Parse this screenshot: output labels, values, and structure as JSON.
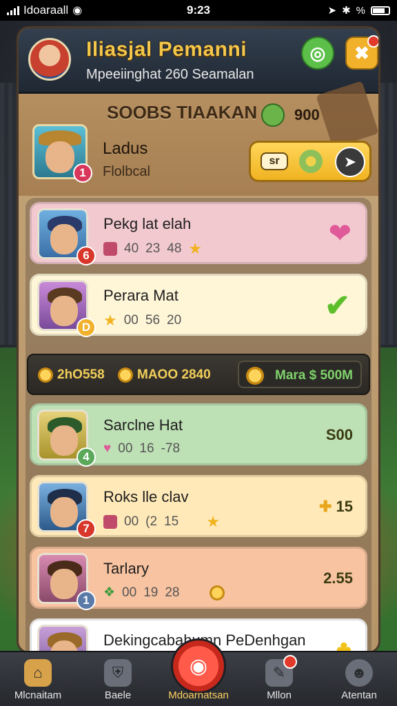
{
  "status_bar": {
    "carrier": "Idoaraall",
    "time": "9:23",
    "battery_text": "%"
  },
  "header": {
    "title": "Iliasjal Pemanni",
    "subtitle": "Mpeeiinghat 260 Seamalan"
  },
  "top_section": {
    "title": "SOOBS TIAAKAN",
    "count": "900",
    "player": {
      "name": "Ladus",
      "position": "Flolbcal",
      "badge": "1",
      "button_chip": "sr"
    }
  },
  "list": {
    "rows": [
      {
        "title": "Pekg lat elah",
        "stats": [
          "40",
          "23",
          "48"
        ],
        "badge": "6",
        "right": ""
      },
      {
        "title": "Perara Mat",
        "stats": [
          "00",
          "56",
          "20"
        ],
        "badge": "D",
        "right": ""
      },
      {
        "title": "Sarclne Hat",
        "stats": [
          "00",
          "16",
          "-78"
        ],
        "badge": "4",
        "right": "S00"
      },
      {
        "title": "Roks lle clav",
        "stats": [
          "00",
          "(2",
          "15"
        ],
        "badge": "7",
        "right": "15"
      },
      {
        "title": "Tarlary",
        "stats": [
          "00",
          "19",
          "28"
        ],
        "badge": "1",
        "right": "2.55"
      },
      {
        "title": "Dekingcabahumn PeDenhgan",
        "stats": [],
        "badge": "",
        "right": ""
      }
    ],
    "info_bar": {
      "left": "2hO558",
      "middle": "MAOO 2840",
      "cash": "Mara $ 500M"
    }
  },
  "bottom_nav": {
    "items": [
      {
        "label": "Mlcnaitam",
        "icon": "home-icon"
      },
      {
        "label": "Baele",
        "icon": "shield-icon"
      },
      {
        "label": "Mdoarnatsan",
        "icon": "ball-icon"
      },
      {
        "label": "Mllon",
        "icon": "pencil-icon"
      },
      {
        "label": "Atentan",
        "icon": "profile-icon"
      }
    ]
  },
  "colors": {
    "accent_gold": "#f4c64a",
    "panel_brown": "#b69568",
    "row_pink": "#f2c9cf",
    "row_cream": "#fff6d8",
    "row_green": "#bde0b5",
    "row_yellow": "#ffe9b8",
    "row_peach": "#f8c3a0",
    "row_white": "#ffffff",
    "nav_red": "#e23a2a"
  }
}
